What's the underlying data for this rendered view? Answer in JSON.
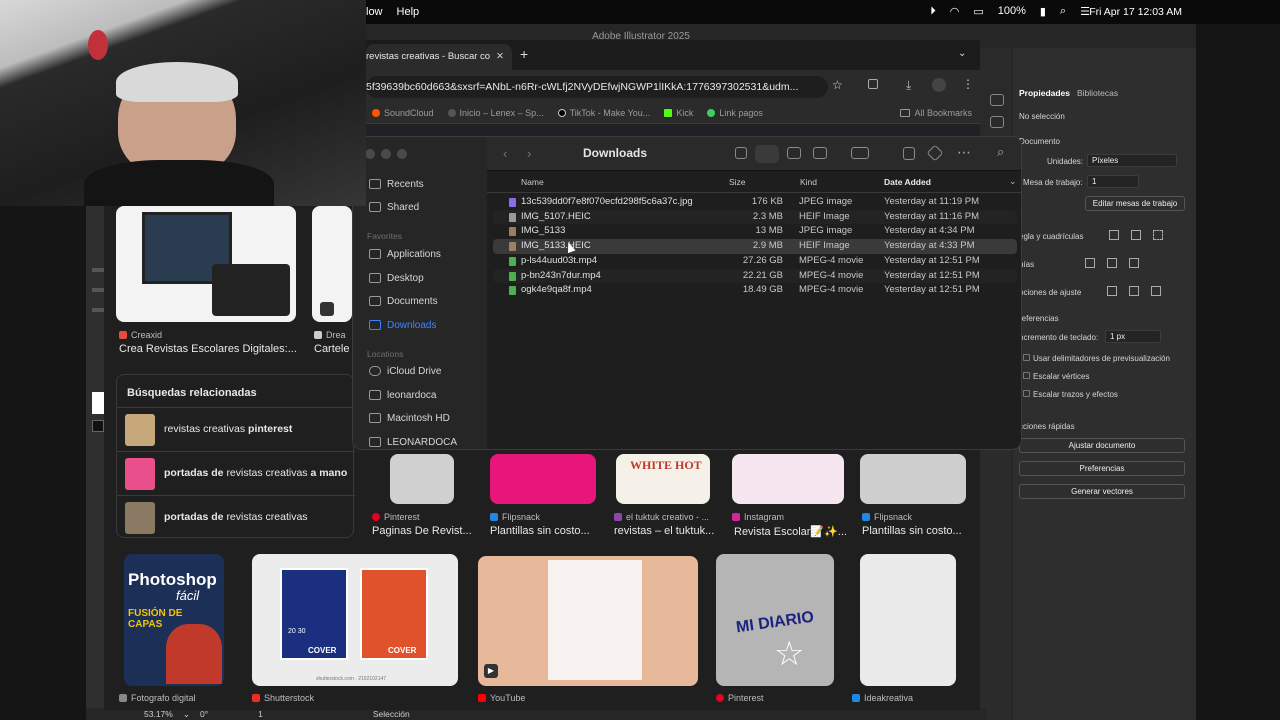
{
  "menubar": {
    "items": [
      "low",
      "Help"
    ],
    "battery": "100%",
    "clock": "Fri Apr 17  12:03 AM"
  },
  "illustrator": {
    "window_title": "Adobe Illustrator 2025",
    "status": {
      "zoom": "53.17%",
      "rotation": "0°",
      "artboard": "1",
      "tool": "Selección"
    },
    "panel_tabs": [
      "Propiedades",
      "Bibliotecas"
    ],
    "no_selection": "No selección",
    "document_label": "Documento",
    "units_label": "Unidades:",
    "units_value": "Píxeles",
    "artboard_label": "Mesa de trabajo:",
    "artboard_value": "1",
    "edit_artboards": "Editar mesas de trabajo",
    "rulers_grids": "egla y cuadrículas",
    "guides": "uías",
    "snap_options": "pciones de ajuste",
    "preferences_section": "referencias",
    "keyboard_increment_label": "ncremento de teclado:",
    "keyboard_increment_value": "1 px",
    "checkboxes": [
      "Usar delimitadores de previsualización",
      "Escalar vértices",
      "Escalar trazos y efectos"
    ],
    "quick_actions": "cciones rápidas",
    "buttons": [
      "Ajustar documento",
      "Preferencias",
      "Generar vectores"
    ]
  },
  "browser": {
    "tab_title": "revistas creativas - Buscar co",
    "new_tab": "+",
    "url": "5f39639bc60d663&sxsrf=ANbL-n6Rr-cWLfj2NVyDEfwjNGWP1lIKkA:1776397302531&udm...",
    "bookmarks": [
      "SoundCloud",
      "Inicio – Lenex – Sp...",
      "TikTok - Make You...",
      "Kick",
      "Link pagos"
    ],
    "all_bookmarks": "All Bookmarks"
  },
  "images": {
    "top_cards": [
      {
        "source": "Creaxid",
        "caption": "Crea Revistas Escolares Digitales:..."
      },
      {
        "source": "Drea",
        "caption": "Cartele"
      }
    ],
    "related": {
      "heading": "Búsquedas relacionadas",
      "items": [
        {
          "plain": "revistas creativas ",
          "bold": "pinterest",
          "lead_bold": ""
        },
        {
          "lead_bold": "portadas de ",
          "plain": "revistas creativas ",
          "bold": "a mano"
        },
        {
          "lead_bold": "portadas de ",
          "plain": "revistas creativas",
          "bold": ""
        }
      ]
    },
    "mid_cards": [
      {
        "source": "Pinterest",
        "caption": "Paginas De Revist..."
      },
      {
        "source": "Flipsnack",
        "caption": "Plantillas sin costo..."
      },
      {
        "source": "el tuktuk creativo - ...",
        "caption": "revistas – el tuktuk..."
      },
      {
        "source": "Instagram",
        "caption": "Revista Escolar📝✨..."
      },
      {
        "source": "Flipsnack",
        "caption": "Plantillas sin costo..."
      }
    ],
    "bottom_sources": [
      "Fotografo digital",
      "Shutterstock",
      "YouTube",
      "Pinterest",
      "Ideakreativa"
    ],
    "photoshop_title": "Photoshop",
    "photoshop_sub": "fácil",
    "photoshop_feature": "FUSIÓN DE CAPAS",
    "cover_text": "COVER",
    "cover_year": "20 30",
    "mi_diario": "MI DIARIO",
    "watermark": "shutterstock.com · 2192102147"
  },
  "finder": {
    "title": "Downloads",
    "sidebar": {
      "favorites_head": "Favorites",
      "locations_head": "Locations",
      "top": [
        "Recents",
        "Shared"
      ],
      "favorites": [
        "Applications",
        "Desktop",
        "Documents",
        "Downloads"
      ],
      "locations": [
        "iCloud Drive",
        "leonardoca",
        "Macintosh HD",
        "LEONARDOCA"
      ]
    },
    "columns": {
      "name": "Name",
      "size": "Size",
      "kind": "Kind",
      "date": "Date Added"
    },
    "files": [
      {
        "name": "13c539dd0f7e8f070ecfd298f5c6a37c.jpg",
        "size": "176 KB",
        "kind": "JPEG image",
        "date": "Yesterday at 11:19 PM",
        "icon_color": "#8a6de0"
      },
      {
        "name": "IMG_5107.HEIC",
        "size": "2.3 MB",
        "kind": "HEIF Image",
        "date": "Yesterday at 11:16 PM",
        "icon_color": "#9a9a9a"
      },
      {
        "name": "IMG_5133",
        "size": "13 MB",
        "kind": "JPEG image",
        "date": "Yesterday at 4:34 PM",
        "icon_color": "#9a7d5a"
      },
      {
        "name": "IMG_5133.HEIC",
        "size": "2.9 MB",
        "kind": "HEIF Image",
        "date": "Yesterday at 4:33 PM",
        "icon_color": "#a08060"
      },
      {
        "name": "p-ls44uud03t.mp4",
        "size": "27.26 GB",
        "kind": "MPEG-4 movie",
        "date": "Yesterday at 12:51 PM",
        "icon_color": "#4caf50"
      },
      {
        "name": "p-bn243n7dur.mp4",
        "size": "22.21 GB",
        "kind": "MPEG-4 movie",
        "date": "Yesterday at 12:51 PM",
        "icon_color": "#4caf50"
      },
      {
        "name": "ogk4e9qa8f.mp4",
        "size": "18.49 GB",
        "kind": "MPEG-4 movie",
        "date": "Yesterday at 12:51 PM",
        "icon_color": "#4caf50"
      }
    ]
  }
}
